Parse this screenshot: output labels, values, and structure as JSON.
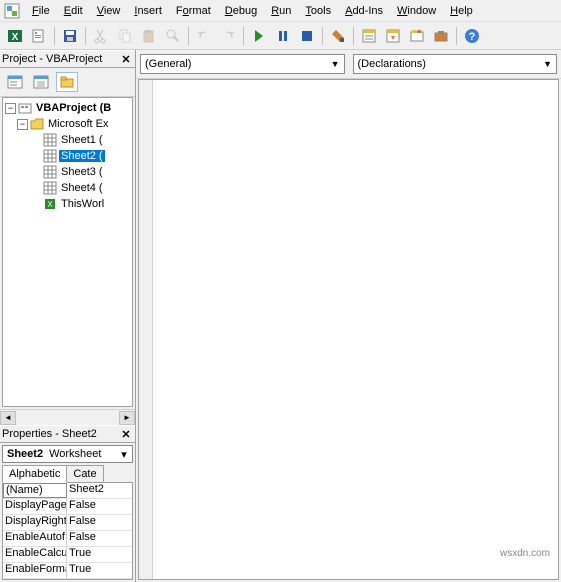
{
  "menu": {
    "file": "File",
    "edit": "Edit",
    "view": "View",
    "insert": "Insert",
    "format": "Format",
    "debug": "Debug",
    "run": "Run",
    "tools": "Tools",
    "addins": "Add-Ins",
    "window": "Window",
    "help": "Help"
  },
  "project_panel": {
    "title": "Project - VBAProject",
    "root": "VBAProject (B",
    "folder": "Microsoft Ex",
    "sheets": [
      "Sheet1 (",
      "Sheet2 (",
      "Sheet3 (",
      "Sheet4 ("
    ],
    "workbook": "ThisWorl",
    "selected": "Sheet2 ("
  },
  "properties_panel": {
    "title": "Properties - Sheet2",
    "object_name": "Sheet2",
    "object_type": "Worksheet",
    "tab_alpha": "Alphabetic",
    "tab_cat": "Cate",
    "rows": [
      {
        "k": "(Name)",
        "v": "Sheet2"
      },
      {
        "k": "DisplayPage",
        "v": "False"
      },
      {
        "k": "DisplayRight",
        "v": "False"
      },
      {
        "k": "EnableAutof",
        "v": "False"
      },
      {
        "k": "EnableCalcu",
        "v": "True"
      },
      {
        "k": "EnableForma",
        "v": "True"
      }
    ]
  },
  "code": {
    "object_combo": "(General)",
    "proc_combo": "(Declarations)"
  },
  "watermark": "wsxdn.com"
}
